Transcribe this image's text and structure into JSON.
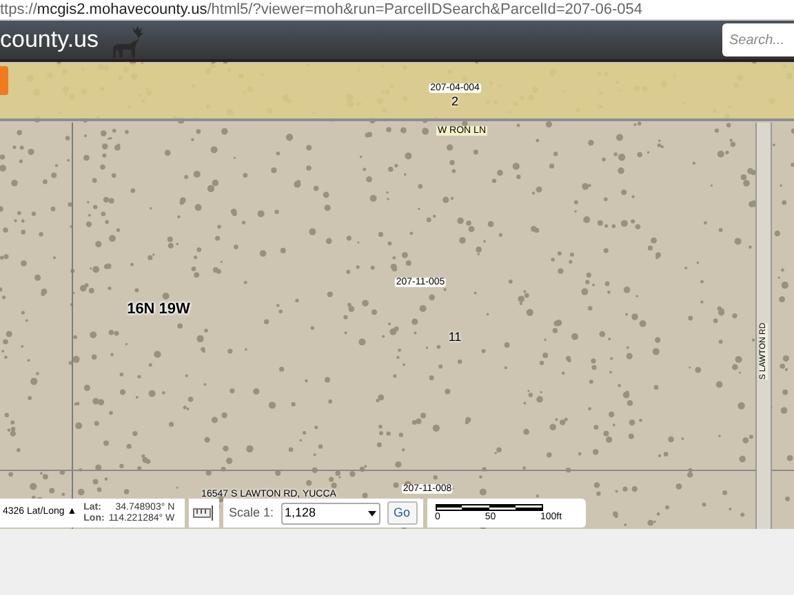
{
  "browser": {
    "url": "ttps://**mcgis2.mohavecounty.us**/html5/?viewer=moh&run=ParcelIDSearch&ParcelId=207-06-054"
  },
  "header": {
    "site_title": "county.us",
    "search": {
      "placeholder": "Search..."
    }
  },
  "map": {
    "labels": [
      {
        "kind": "parcel",
        "text": "207-04-004"
      },
      {
        "kind": "lot",
        "text": "2"
      },
      {
        "kind": "road",
        "text": "W RON LN"
      },
      {
        "kind": "parcel",
        "text": "207-11-005"
      },
      {
        "kind": "township",
        "text": "16N 19W"
      },
      {
        "kind": "lot",
        "text": "11"
      },
      {
        "kind": "road-vertical",
        "text": "S LAWTON RD"
      },
      {
        "kind": "address",
        "text": "16547 S LAWTON RD, YUCCA"
      },
      {
        "kind": "parcel",
        "text": "207-11-008"
      }
    ]
  },
  "toolbar": {
    "coord_system": "4326 Lat/Long ▲",
    "lat_label": "Lat:",
    "lat": "34.748903° N",
    "lon_label": "Lon:",
    "lon": "114.221284° W",
    "scale_label": "Scale 1:",
    "scale_value": "1,128",
    "go": "Go",
    "scale_bar": [
      "0",
      "50",
      "100ft"
    ]
  }
}
